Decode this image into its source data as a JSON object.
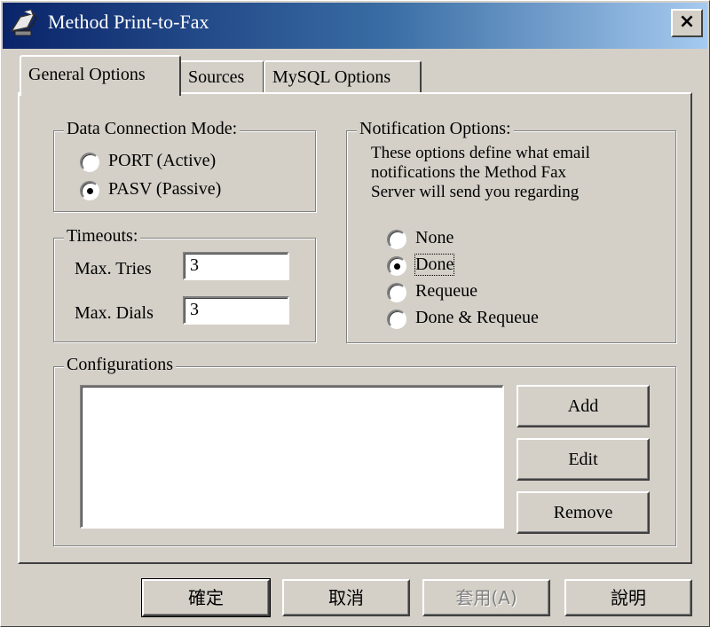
{
  "window": {
    "title": "Method Print-to-Fax",
    "close_label": "×"
  },
  "tabs": [
    {
      "label": "General Options",
      "active": true
    },
    {
      "label": "Sources",
      "active": false
    },
    {
      "label": "MySQL Options",
      "active": false
    }
  ],
  "data_connection": {
    "legend": "Data Connection Mode:",
    "options": [
      {
        "label": "PORT (Active)",
        "selected": false
      },
      {
        "label": "PASV (Passive)",
        "selected": true
      }
    ]
  },
  "timeouts": {
    "legend": "Timeouts:",
    "max_tries": {
      "label": "Max. Tries",
      "value": "3"
    },
    "max_dials": {
      "label": "Max. Dials",
      "value": "3"
    }
  },
  "notification": {
    "legend": "Notification Options:",
    "description": [
      "These options define what email",
      "notifications the Method Fax",
      "Server will send you regarding"
    ],
    "options": [
      {
        "label": "None",
        "selected": false
      },
      {
        "label": "Done",
        "selected": true
      },
      {
        "label": "Requeue",
        "selected": false
      },
      {
        "label": "Done & Requeue",
        "selected": false
      }
    ]
  },
  "configurations": {
    "legend": "Configurations",
    "buttons": {
      "add": "Add",
      "edit": "Edit",
      "remove": "Remove"
    }
  },
  "footer": {
    "ok": "確定",
    "cancel": "取消",
    "apply": "套用(A)",
    "help": "說明"
  },
  "colors": {
    "face": "#d4d0c8",
    "title_start": "#0a246a",
    "title_end": "#a6caf0"
  }
}
